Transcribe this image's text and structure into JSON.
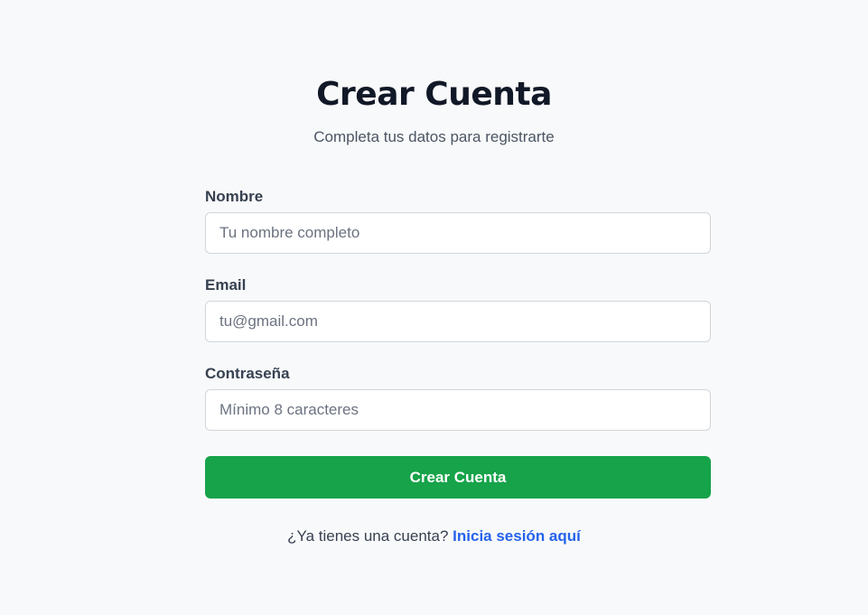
{
  "header": {
    "title": "Crear Cuenta",
    "subtitle": "Completa tus datos para registrarte"
  },
  "form": {
    "fields": [
      {
        "label": "Nombre",
        "placeholder": "Tu nombre completo",
        "value": ""
      },
      {
        "label": "Email",
        "placeholder": "tu@gmail.com",
        "value": ""
      },
      {
        "label": "Contraseña",
        "placeholder": "Mínimo 8 caracteres",
        "value": ""
      }
    ],
    "submit_label": "Crear Cuenta"
  },
  "footer": {
    "prompt": "¿Ya tienes una cuenta?",
    "link_label": "Inicia sesión aquí"
  },
  "colors": {
    "background": "#f8f9fa",
    "primary_button": "#16a34a",
    "link": "#2563eb",
    "title": "#111827"
  }
}
